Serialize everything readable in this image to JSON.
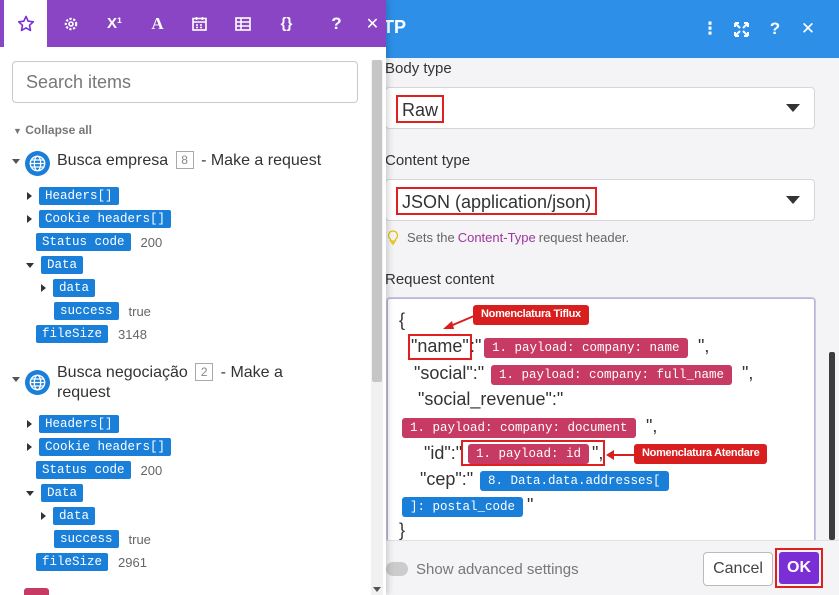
{
  "dialog": {
    "title": "TP",
    "body_type": {
      "label": "Body type",
      "value": "Raw"
    },
    "content_type": {
      "label": "Content type",
      "value": "JSON (application/json)",
      "hint_prefix": "Sets the",
      "hint_link": "Content-Type",
      "hint_suffix": "request header."
    },
    "request_content": {
      "label": "Request content",
      "lines": {
        "open": "{",
        "name_key": "\"name\"",
        "name_sep": ":\"",
        "name_end": "\",",
        "social_key": "\"social\":\"",
        "social_end": "\",",
        "revenue_key": "\"social_revenue\":\"",
        "revenue_end": "\",",
        "id_key": "\"id\":\"",
        "id_end": "\",",
        "cep_key": "\"cep\":\"",
        "cep_end": "\"",
        "close": "}"
      },
      "pills": {
        "company_name": "1. payload: company: name",
        "company_full_name": "1. payload: company: full_name",
        "company_document": "1. payload: company: document",
        "payload_id": "1. payload: id",
        "addresses_a": "8. Data.data.addresses[",
        "addresses_b": "]: postal_code"
      },
      "annotations": {
        "tiflux": "Nomenclatura Tiflux",
        "atendare": "Nomenclatura Atendare"
      }
    },
    "advanced_label": "Show advanced settings",
    "cancel_label": "Cancel",
    "ok_label": "OK",
    "colors": {
      "header": "#2d8fe8",
      "ok": "#7b2ed6",
      "pill_red": "#c63a63",
      "pill_blue": "#1a7fd9",
      "highlight": "#e02020"
    }
  },
  "panel": {
    "tabs": [
      "star-icon",
      "gear-icon",
      "superscript-icon",
      "text-icon",
      "calendar-icon",
      "table-icon",
      "braces-icon",
      "help-icon",
      "close-icon"
    ],
    "search_placeholder": "Search items",
    "collapse_all": "Collapse all",
    "modules": [
      {
        "name": "Busca empresa",
        "badge": "8",
        "suffix": "- Make a request",
        "items": {
          "headers": "Headers[]",
          "cookie": "Cookie headers[]",
          "status_code": "Status code",
          "status_value": "200",
          "data": "Data",
          "data_sub": "data",
          "success": "success",
          "success_value": "true",
          "filesize": "fileSize",
          "filesize_value": "3148"
        }
      },
      {
        "name_line1": "Busca negociação",
        "badge": "2",
        "suffix": "- Make a",
        "name_line2": "request",
        "items": {
          "headers": "Headers[]",
          "cookie": "Cookie headers[]",
          "status_code": "Status code",
          "status_value": "200",
          "data": "Data",
          "data_sub": "data",
          "success": "success",
          "success_value": "true",
          "filesize": "fileSize",
          "filesize_value": "2961"
        }
      }
    ]
  }
}
